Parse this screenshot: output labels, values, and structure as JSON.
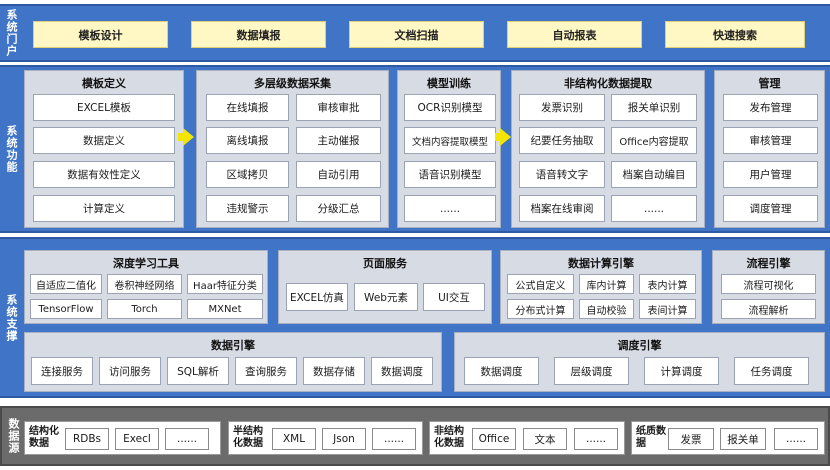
{
  "portal": {
    "title": "系统门户",
    "buttons": [
      "模板设计",
      "数据填报",
      "文档扫描",
      "自动报表",
      "快速搜索"
    ]
  },
  "function": {
    "title": "系统功能",
    "panels": [
      {
        "title": "模板定义",
        "cells": [
          "EXCEL模板",
          "数据定义",
          "数据有效性定义",
          "计算定义"
        ]
      },
      {
        "title": "多层级数据采集",
        "cells": [
          "在线填报",
          "审核审批",
          "离线填报",
          "主动催报",
          "区域拷贝",
          "自动引用",
          "违规警示",
          "分级汇总"
        ]
      },
      {
        "title": "模型训练",
        "cells": [
          "OCR识别模型",
          "文档内容提取模型",
          "语音识别模型",
          "......"
        ]
      },
      {
        "title": "非结构化数据提取",
        "cells": [
          "发票识别",
          "报关单识别",
          "纪要任务抽取",
          "Office内容提取",
          "语音转文字",
          "档案自动编目",
          "档案在线审阅",
          "......"
        ]
      },
      {
        "title": "管理",
        "cells": [
          "发布管理",
          "审核管理",
          "用户管理",
          "调度管理"
        ]
      }
    ]
  },
  "support": {
    "title": "系统支撑",
    "deep_learning": {
      "title": "深度学习工具",
      "cells": [
        "自适应二值化",
        "卷积神经网络",
        "Haar特征分类",
        "TensorFlow",
        "Torch",
        "MXNet"
      ]
    },
    "page_service": {
      "title": "页面服务",
      "cells": [
        "EXCEL仿真",
        "Web元素",
        "UI交互"
      ]
    },
    "data_calc": {
      "title": "数据计算引擎",
      "cells": [
        "公式自定义",
        "库内计算",
        "表内计算",
        "分布式计算",
        "自动校验",
        "表间计算"
      ]
    },
    "flow": {
      "title": "流程引擎",
      "cells": [
        "流程可视化",
        "流程解析"
      ]
    },
    "data_engine": {
      "title": "数据引擎",
      "cells": [
        "连接服务",
        "访问服务",
        "SQL解析",
        "查询服务",
        "数据存储",
        "数据调度"
      ]
    },
    "schedule": {
      "title": "调度引擎",
      "cells": [
        "数据调度",
        "层级调度",
        "计算调度",
        "任务调度"
      ]
    }
  },
  "source": {
    "title": "数据源",
    "groups": [
      {
        "label": "结构化数据",
        "cells": [
          "RDBs",
          "Execl",
          "......"
        ]
      },
      {
        "label": "半结构化数据",
        "cells": [
          "XML",
          "Json",
          "......"
        ]
      },
      {
        "label": "非结构化数据",
        "cells": [
          "Office",
          "文本",
          "......"
        ]
      },
      {
        "label": "纸质数据",
        "cells": [
          "发票",
          "报关单",
          "......"
        ]
      }
    ]
  },
  "colors": {
    "band_blue": "#3f74c6",
    "portal_button": "#fff7c4",
    "panel": "#d7dbe3",
    "arrow": "#f2e600",
    "band_gray": "#6b6b6b"
  }
}
